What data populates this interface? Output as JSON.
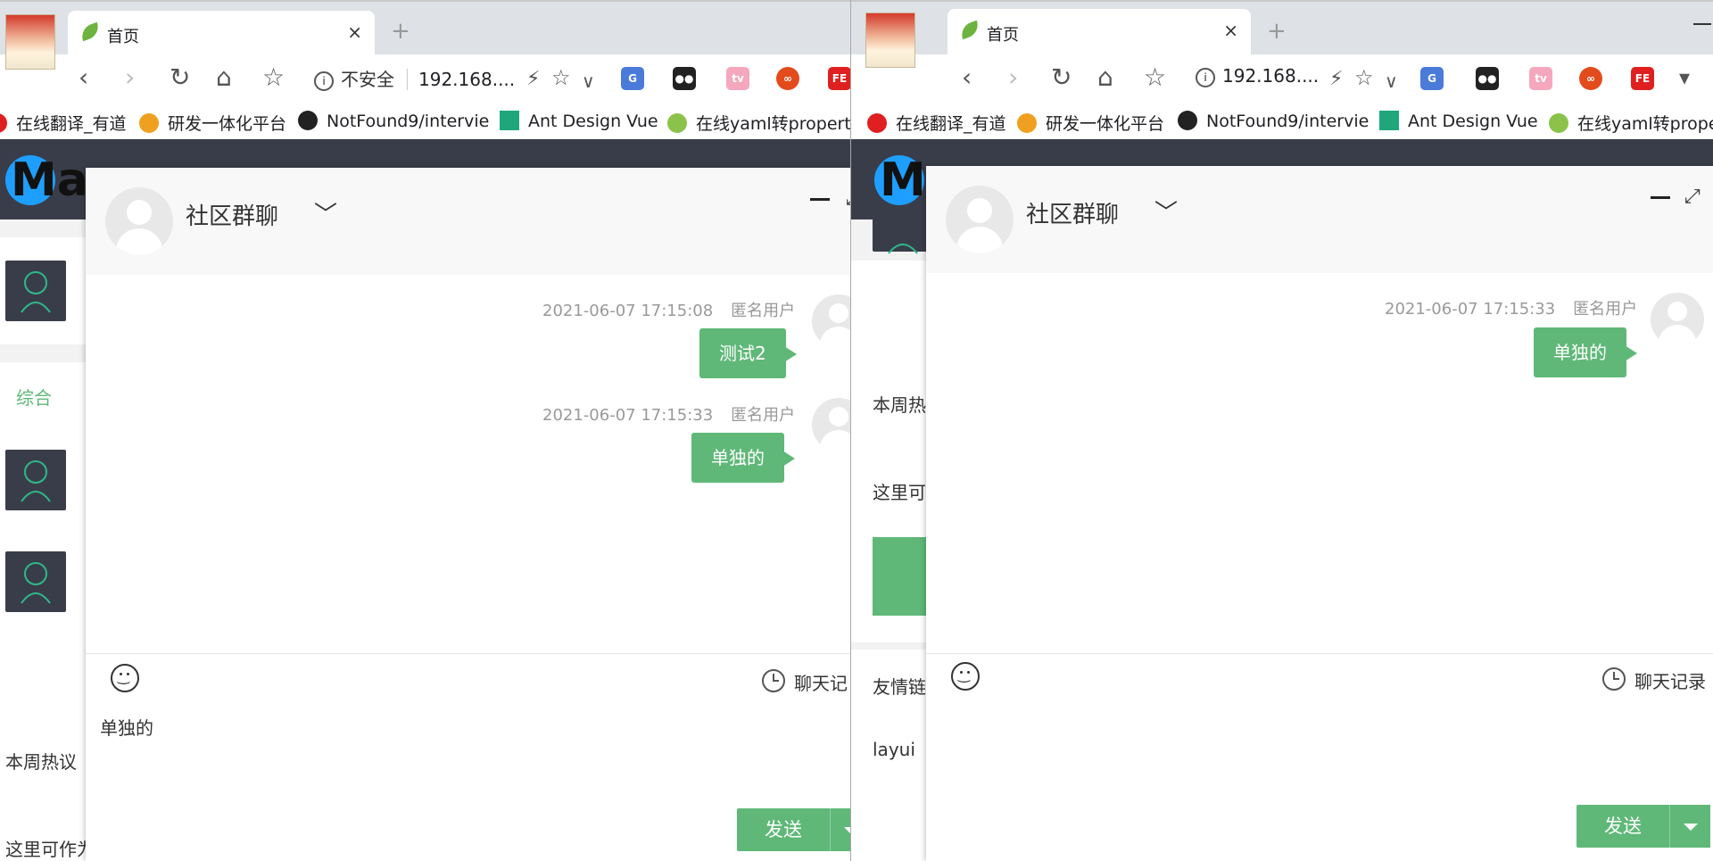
{
  "browser": {
    "tab_title": "首页",
    "tab_close": "×",
    "new_tab": "+",
    "security_label": "不安全",
    "address_short": "192.168....",
    "ext_fe": "FE",
    "bookmarks": [
      {
        "label": "在线翻译_有道",
        "color": "#e02020"
      },
      {
        "label": "研发一体化平台",
        "color": "#f0a020"
      },
      {
        "label": "NotFound9/intervie",
        "color": "#222222"
      },
      {
        "label": "Ant Design Vue",
        "color": "#1fa67a"
      },
      {
        "label": "在线yaml转propertie",
        "color": "#8bc34a"
      }
    ],
    "bookmarks_right": [
      {
        "label": "在线翻译_有道",
        "color": "#e02020"
      },
      {
        "label": "研发一体化平台",
        "color": "#f0a020"
      },
      {
        "label": "NotFound9/intervie",
        "color": "#222222"
      },
      {
        "label": "Ant Design Vue",
        "color": "#1fa67a"
      },
      {
        "label": "在线yaml转prope",
        "color": "#8bc34a"
      }
    ]
  },
  "site": {
    "logo": "Ma",
    "left_texts": {
      "tab": "综合",
      "hot": "本周热议",
      "here": "这里可作为"
    },
    "right_texts": {
      "hot": "本周热",
      "here": "这里可",
      "links": "友情链",
      "layui": "layui"
    }
  },
  "chat": {
    "title": "社区群聊",
    "chevron": "﹀",
    "maximize": "⤢",
    "history_label": "聊天记录",
    "history_label_left": "聊天记",
    "send_label": "发送",
    "input_value": "单独的",
    "left_messages": [
      {
        "time": "2021-06-07 17:15:08",
        "user": "匿名用户",
        "text": "测试2"
      },
      {
        "time": "2021-06-07 17:15:33",
        "user": "匿名用户",
        "text": "单独的"
      }
    ],
    "right_messages": [
      {
        "time": "2021-06-07 17:15:33",
        "user": "匿名用户",
        "text": "单独的"
      }
    ]
  },
  "colors": {
    "accent": "#5fb878",
    "header": "#393d49",
    "logo": "#1e9fff"
  }
}
